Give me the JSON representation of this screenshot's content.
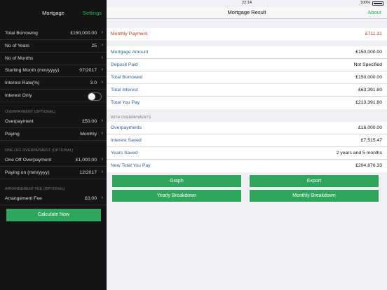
{
  "status": {
    "time": "22:14",
    "battery": "100%"
  },
  "left": {
    "title": "Mortgage",
    "settings": "Settings",
    "rows_main": [
      {
        "label": "Total Borrowing",
        "value": "£150,000.00"
      },
      {
        "label": "No of Years",
        "value": "25"
      },
      {
        "label": "No of Months",
        "value": ""
      },
      {
        "label": "Starting Month (mm/yyyy)",
        "value": "07/2017"
      },
      {
        "label": "Interest Rate(%)",
        "value": "3.0"
      }
    ],
    "interest_only": {
      "label": "Interest Only",
      "on": false
    },
    "overpayment_section": "OVERPAYMENT (OPTIONAL)",
    "rows_overpayment": [
      {
        "label": "Overpayment",
        "value": "£50.00"
      },
      {
        "label": "Paying",
        "value": "Monthly"
      }
    ],
    "oneoff_section": "ONE OFF OVERPAYMENT (OPTIONAL)",
    "rows_oneoff": [
      {
        "label": "One Off Overpayment",
        "value": "£1,000.00"
      },
      {
        "label": "Paying on (mm/yyyy)",
        "value": "12/2017"
      }
    ],
    "fee_section": "ARRANGEMENT FEE (OPTIONAL)",
    "rows_fee": [
      {
        "label": "Arrangement Fee",
        "value": "£0.00"
      }
    ],
    "calculate": "Calculate Now"
  },
  "right": {
    "title": "Mortgage Result",
    "about": "About",
    "monthly": {
      "label": "Monthly Payment",
      "value": "£711.31"
    },
    "results": [
      {
        "label": "Mortgage Amount",
        "value": "£150,000.00"
      },
      {
        "label": "Deposit Paid",
        "value": "Not Specified"
      },
      {
        "label": "Total Borrowed",
        "value": "£150,000.00"
      },
      {
        "label": "Total Interest",
        "value": "£63,391.80"
      },
      {
        "label": "Total You Pay",
        "value": "£213,391.80"
      }
    ],
    "with_overpayments_section": "WITH OVERPAYMENTS",
    "overpay_results": [
      {
        "label": "Overpayments",
        "value": "£16,000.00"
      },
      {
        "label": "Interest Saved",
        "value": "£7,515.47"
      },
      {
        "label": "Years Saved",
        "value": "2 years and 5 months"
      },
      {
        "label": "New Total You Pay",
        "value": "£204,876.33"
      }
    ],
    "buttons": {
      "graph": "Graph",
      "export": "Export",
      "yearly": "Yearly Breakdown",
      "monthly": "Monthly Breakdown"
    }
  },
  "colors": {
    "accent_green": "#2fa65d",
    "link_blue": "#2e5f96",
    "alert_red": "#b33a1b",
    "dark_panel": "#141414"
  }
}
